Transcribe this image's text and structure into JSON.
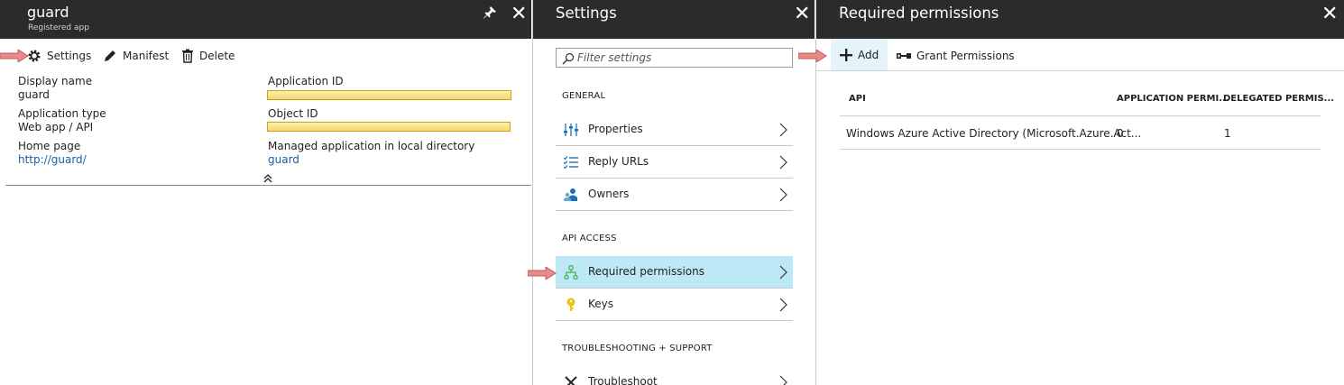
{
  "blade_app": {
    "title": "guard",
    "subtitle": "Registered app",
    "toolbar": {
      "settings_label": "Settings",
      "manifest_label": "Manifest",
      "delete_label": "Delete"
    },
    "essentials": {
      "display_name_label": "Display name",
      "display_name_value": "guard",
      "app_type_label": "Application type",
      "app_type_value": "Web app / API",
      "home_page_label": "Home page",
      "home_page_value": "http://guard/",
      "app_id_label": "Application ID",
      "object_id_label": "Object ID",
      "managed_app_label": "Managed application in local directory",
      "managed_app_value": "guard"
    }
  },
  "blade_settings": {
    "title": "Settings",
    "search_placeholder": "Filter settings",
    "sections": {
      "general": "GENERAL",
      "api_access": "API ACCESS",
      "troubleshooting": "TROUBLESHOOTING + SUPPORT"
    },
    "items": {
      "properties": "Properties",
      "reply_urls": "Reply URLs",
      "owners": "Owners",
      "required_permissions": "Required permissions",
      "keys": "Keys",
      "troubleshoot": "Troubleshoot"
    }
  },
  "blade_permissions": {
    "title": "Required permissions",
    "toolbar": {
      "add_label": "Add",
      "grant_label": "Grant Permissions"
    },
    "table": {
      "columns": [
        "API",
        "APPLICATION PERMI...",
        "DELEGATED PERMIS..."
      ],
      "rows": [
        [
          "Windows Azure Active Directory (Microsoft.Azure.Act...",
          "0",
          "1"
        ]
      ]
    }
  },
  "colors": {
    "header_bg": "#2b2b2b",
    "selected_bg": "#bde9f7",
    "link": "#1a5fa8",
    "arrow": "#e8898a"
  },
  "icons": {
    "pin": "pin-icon",
    "close": "close-icon",
    "settings": "gear-icon",
    "manifest": "pencil-icon",
    "delete": "trash-icon",
    "add": "plus-icon",
    "grant": "key-icon"
  }
}
